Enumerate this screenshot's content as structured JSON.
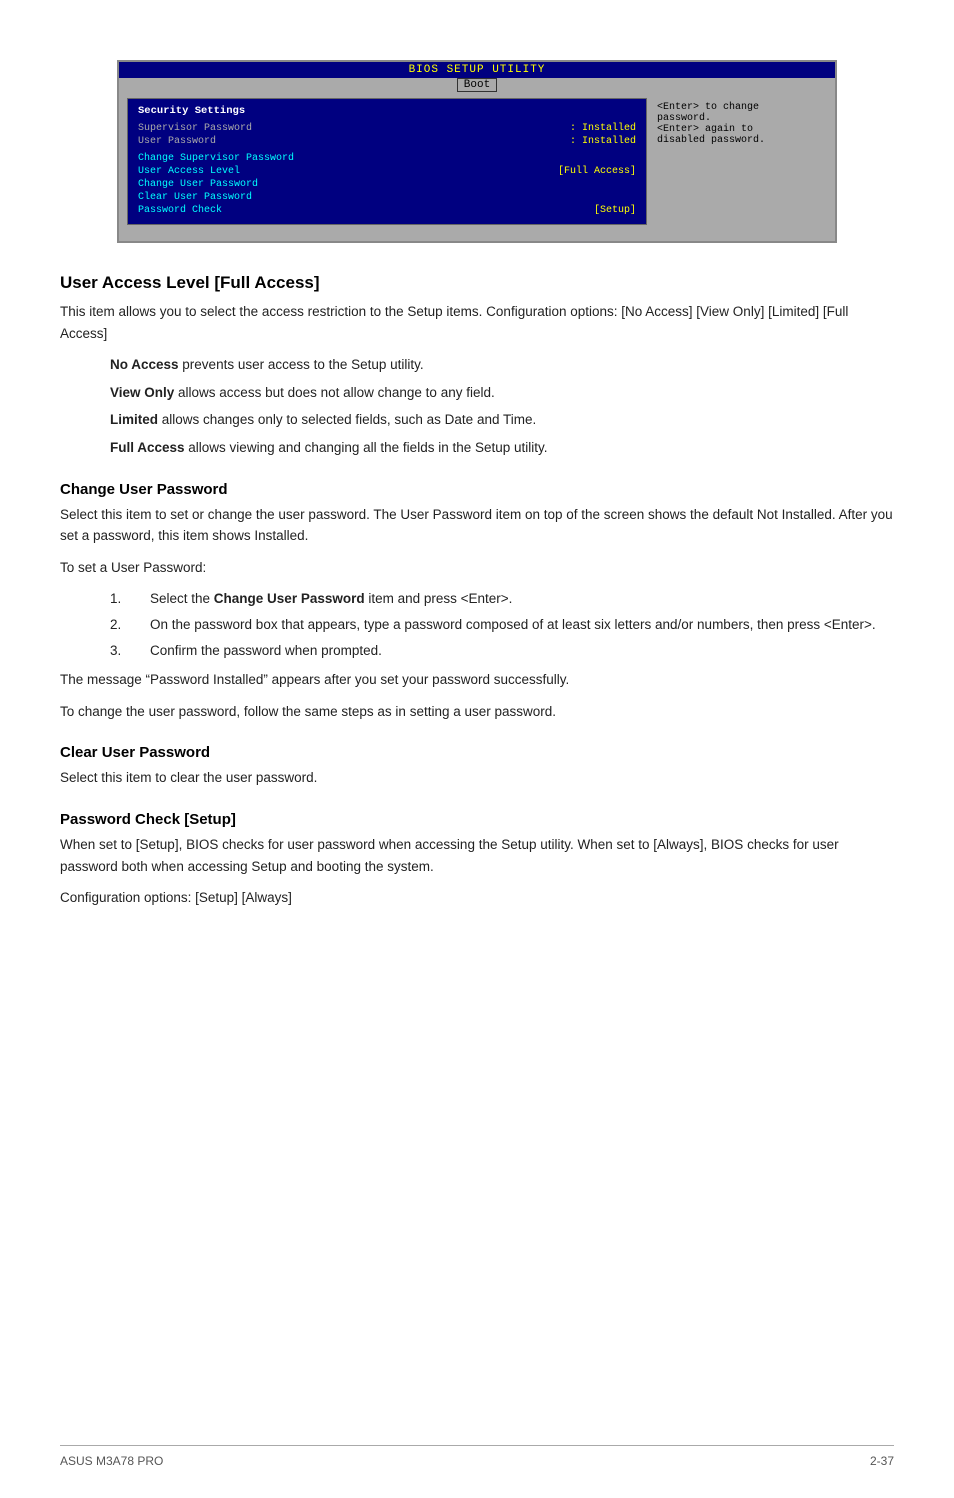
{
  "bios": {
    "title": "BIOS SETUP UTILITY",
    "nav": "Boot",
    "panel_title": "Security Settings",
    "rows": [
      {
        "label": "Supervisor Password",
        "value": ": Installed",
        "highlight": false
      },
      {
        "label": "User Password",
        "value": ": Installed",
        "highlight": false
      },
      {
        "label": "",
        "value": "",
        "highlight": false
      },
      {
        "label": "Change Supervisor Password",
        "value": "",
        "highlight": true
      },
      {
        "label": "User Access Level",
        "value": "[Full Access]",
        "highlight": true
      },
      {
        "label": "Change User Password",
        "value": "",
        "highlight": true
      },
      {
        "label": "Clear User Password",
        "value": "",
        "highlight": true
      },
      {
        "label": "Password Check",
        "value": "[Setup]",
        "highlight": true
      }
    ],
    "help": "<Enter> to change\npassword.\n<Enter> again to\ndisabled password."
  },
  "sections": [
    {
      "heading": "User Access Level [Full Access]",
      "paragraphs": [
        "This item allows you to select the access restriction to the Setup items. Configuration options: [No Access] [View Only] [Limited] [Full Access]"
      ],
      "indented": [
        {
          "term": "No Access",
          "text": " prevents user access to the Setup utility."
        },
        {
          "term": "View Only",
          "text": " allows access but does not allow change to any field."
        },
        {
          "term": "Limited",
          "text": " allows changes only to selected fields, such as Date and Time."
        },
        {
          "term": "Full Access",
          "text": " allows viewing and changing all the fields in the Setup utility."
        }
      ]
    },
    {
      "heading": "Change User Password",
      "paragraphs": [
        "Select this item to set or change the user password. The User Password item on top of the screen shows the default Not Installed. After you set a password, this item shows Installed.",
        "To set a User Password:"
      ],
      "numbered": [
        "Select the <b>Change User Password</b> item and press <Enter>.",
        "On the password box that appears, type a password composed of at least six letters and/or numbers, then press <Enter>.",
        "Confirm the password when prompted."
      ],
      "after": [
        "The message “Password Installed” appears after you set your password successfully.",
        "To change the user password, follow the same steps as in setting a user password."
      ]
    },
    {
      "heading": "Clear User Password",
      "paragraphs": [
        "Select this item to clear the user password."
      ]
    },
    {
      "heading": "Password Check [Setup]",
      "paragraphs": [
        "When set to [Setup], BIOS checks for user password when accessing the Setup utility. When set to [Always], BIOS checks for user password both when accessing Setup and booting the system.",
        "Configuration options: [Setup] [Always]"
      ]
    }
  ],
  "footer": {
    "left": "ASUS M3A78 PRO",
    "right": "2-37"
  }
}
